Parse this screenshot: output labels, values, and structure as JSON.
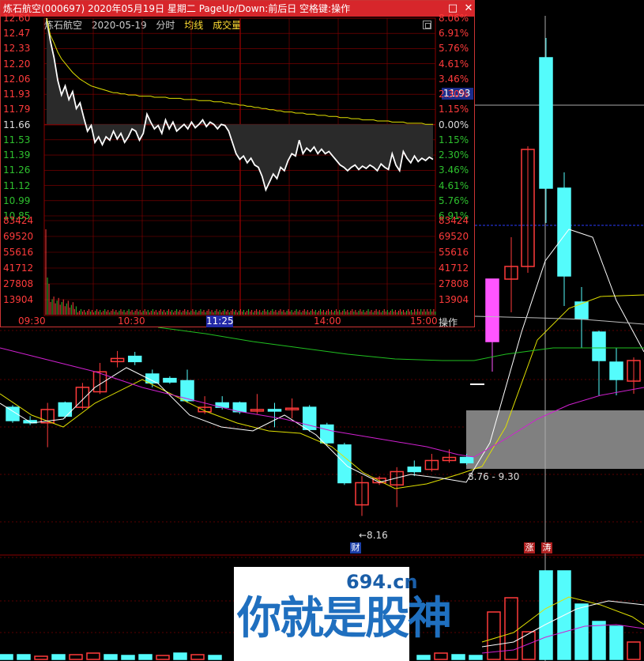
{
  "window": {
    "title": "炼石航空(000697) 2020年05月19日 星期二 PageUp/Down:前后日 空格键:操作",
    "controls": [
      "□",
      "✕"
    ]
  },
  "subheader": {
    "stock": "炼石航空",
    "date": "2020-05-19",
    "mode": "分时",
    "ma_label": "均线",
    "vol_label": "成交量"
  },
  "colors": {
    "up": "#ff3b3b",
    "down": "#54fcfc",
    "ma_yellow": "#e0e000",
    "ma_white": "#ffffff",
    "ma_magenta": "#d020d0",
    "ma_green": "#20c020",
    "flat": "#ffffff",
    "grid": "#8b0000"
  },
  "intraday": {
    "price_labels": [
      "12.60",
      "12.47",
      "12.33",
      "12.20",
      "12.06",
      "11.93",
      "11.79",
      "11.66",
      "11.53",
      "11.39",
      "11.26",
      "11.12",
      "10.99",
      "10.85"
    ],
    "pct_labels": [
      "8.06%",
      "6.91%",
      "5.76%",
      "4.61%",
      "3.46%",
      "2.30%",
      "1.15%",
      "0.00%",
      "1.15%",
      "2.30%",
      "3.46%",
      "4.61%",
      "5.76%",
      "6.91%"
    ],
    "vol_labels": [
      "83424",
      "69520",
      "55616",
      "41712",
      "27808",
      "13904"
    ],
    "time_labels": [
      "09:30",
      "10:30",
      "11:25",
      "14:00",
      "15:00"
    ],
    "prev_close": 11.66,
    "current_price_tag": "11.93",
    "op_label": "操作",
    "price_series": [
      12.6,
      12.4,
      12.25,
      12.05,
      11.92,
      12.0,
      11.88,
      11.95,
      11.8,
      11.85,
      11.72,
      11.6,
      11.65,
      11.5,
      11.55,
      11.48,
      11.55,
      11.52,
      11.6,
      11.53,
      11.58,
      11.5,
      11.55,
      11.62,
      11.6,
      11.52,
      11.58,
      11.75,
      11.68,
      11.62,
      11.65,
      11.58,
      11.7,
      11.62,
      11.68,
      11.6,
      11.63,
      11.66,
      11.62,
      11.68,
      11.63,
      11.66,
      11.7,
      11.64,
      11.68,
      11.66,
      11.62,
      11.66,
      11.65,
      11.6,
      11.5,
      11.4,
      11.35,
      11.38,
      11.32,
      11.36,
      11.3,
      11.28,
      11.2,
      11.08,
      11.15,
      11.22,
      11.18,
      11.28,
      11.25,
      11.34,
      11.4,
      11.38,
      11.52,
      11.4,
      11.45,
      11.42,
      11.46,
      11.4,
      11.44,
      11.4,
      11.42,
      11.38,
      11.34,
      11.3,
      11.28,
      11.25,
      11.28,
      11.3,
      11.26,
      11.29,
      11.27,
      11.3,
      11.28,
      11.25,
      11.31,
      11.28,
      11.26,
      11.4,
      11.3,
      11.25,
      11.42,
      11.36,
      11.32,
      11.38,
      11.33,
      11.36,
      11.34,
      11.37,
      11.35
    ],
    "avg_series": [
      12.6,
      12.45,
      12.38,
      12.3,
      12.24,
      12.2,
      12.16,
      12.12,
      12.09,
      12.06,
      12.04,
      12.02,
      12.0,
      11.99,
      11.98,
      11.97,
      11.96,
      11.95,
      11.94,
      11.94,
      11.93,
      11.93,
      11.92,
      11.92,
      11.92,
      11.91,
      11.91,
      11.91,
      11.91,
      11.9,
      11.9,
      11.9,
      11.9,
      11.89,
      11.89,
      11.89,
      11.89,
      11.88,
      11.88,
      11.88,
      11.88,
      11.87,
      11.87,
      11.87,
      11.87,
      11.86,
      11.86,
      11.86,
      11.85,
      11.85,
      11.84,
      11.84,
      11.83,
      11.83,
      11.82,
      11.82,
      11.81,
      11.81,
      11.8,
      11.8,
      11.79,
      11.79,
      11.78,
      11.78,
      11.77,
      11.77,
      11.77,
      11.76,
      11.76,
      11.76,
      11.75,
      11.75,
      11.75,
      11.74,
      11.74,
      11.74,
      11.73,
      11.73,
      11.73,
      11.72,
      11.72,
      11.72,
      11.71,
      11.71,
      11.71,
      11.7,
      11.7,
      11.7,
      11.7,
      11.69,
      11.69,
      11.69,
      11.69,
      11.68,
      11.68,
      11.68,
      11.68,
      11.67,
      11.67,
      11.67,
      11.67,
      11.67,
      11.66,
      11.66,
      11.66
    ]
  },
  "kline": {
    "annotations": {
      "low_label": "←8.16",
      "range_label": "8.76 - 9.30"
    },
    "badges": [
      "财",
      "涨",
      "涛"
    ],
    "candles": [
      {
        "o": 10.85,
        "h": 10.9,
        "c": 10.55,
        "l": 10.5
      },
      {
        "o": 10.55,
        "h": 10.65,
        "c": 10.5,
        "l": 10.45
      },
      {
        "o": 10.5,
        "h": 10.95,
        "c": 10.8,
        "l": 9.95
      },
      {
        "o": 10.95,
        "h": 10.98,
        "c": 10.65,
        "l": 10.6
      },
      {
        "o": 10.85,
        "h": 11.4,
        "c": 11.3,
        "l": 10.8
      },
      {
        "o": 11.2,
        "h": 11.85,
        "c": 11.65,
        "l": 11.15
      },
      {
        "o": 11.88,
        "h": 12.12,
        "c": 11.95,
        "l": 11.75
      },
      {
        "o": 12.0,
        "h": 12.1,
        "c": 11.88,
        "l": 11.8
      },
      {
        "o": 11.6,
        "h": 11.7,
        "c": 11.4,
        "l": 11.3
      },
      {
        "o": 11.5,
        "h": 11.55,
        "c": 11.42,
        "l": 11.38
      },
      {
        "o": 11.45,
        "h": 11.7,
        "c": 11.0,
        "l": 10.95
      },
      {
        "o": 10.75,
        "h": 11.1,
        "c": 10.85,
        "l": 10.7
      },
      {
        "o": 10.95,
        "h": 11.1,
        "c": 10.85,
        "l": 10.8
      },
      {
        "o": 10.95,
        "h": 10.98,
        "c": 10.75,
        "l": 10.7
      },
      {
        "o": 10.8,
        "h": 11.15,
        "c": 10.8,
        "l": 10.7
      },
      {
        "o": 10.8,
        "h": 10.95,
        "c": 10.78,
        "l": 10.4
      },
      {
        "o": 10.8,
        "h": 11.05,
        "c": 10.83,
        "l": 10.6
      },
      {
        "o": 10.85,
        "h": 10.9,
        "c": 10.35,
        "l": 10.3
      },
      {
        "o": 10.45,
        "h": 10.5,
        "c": 10.05,
        "l": 10.0
      },
      {
        "o": 10.0,
        "h": 10.05,
        "c": 9.15,
        "l": 9.1
      },
      {
        "o": 8.65,
        "h": 9.3,
        "c": 9.15,
        "l": 8.4
      },
      {
        "o": 9.15,
        "h": 9.3,
        "c": 9.25,
        "l": 9.1
      },
      {
        "o": 9.1,
        "h": 9.5,
        "c": 9.4,
        "l": 8.6
      },
      {
        "o": 9.5,
        "h": 9.65,
        "c": 9.4,
        "l": 9.3
      },
      {
        "o": 9.45,
        "h": 9.8,
        "c": 9.65,
        "l": 9.4
      },
      {
        "o": 9.65,
        "h": 9.9,
        "c": 9.72,
        "l": 9.6
      },
      {
        "o": 9.72,
        "h": 9.8,
        "c": 9.6,
        "l": 9.55
      }
    ]
  },
  "watermark": {
    "site": "694.cn",
    "text": "你就是股神"
  }
}
